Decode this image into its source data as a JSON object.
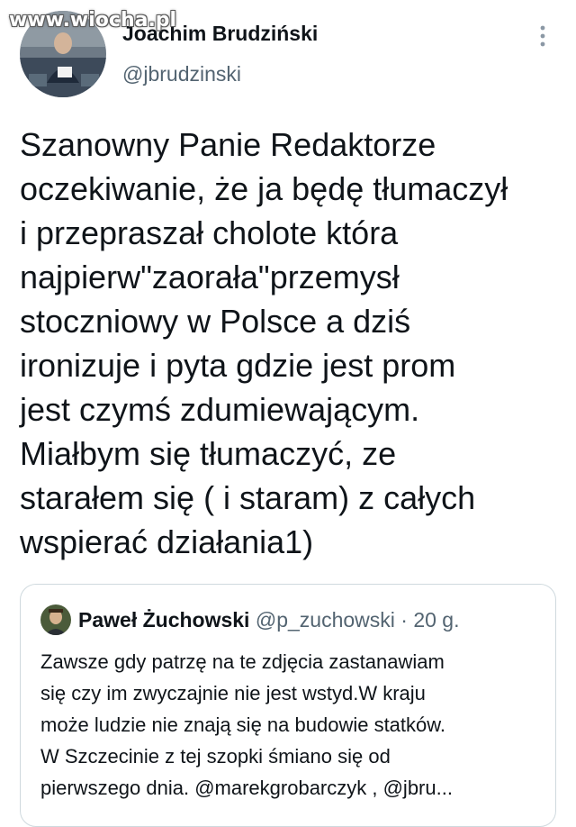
{
  "watermark": "www.wiocha.pl",
  "tweet": {
    "display_name": "Joachim Brudziński",
    "handle": "@jbrudzinski",
    "lines": [
      "Szanowny Panie Redaktorze",
      "oczekiwanie, że ja będę tłumaczył",
      "i przepraszał cholote która",
      "najpierw\"zaorała\"przemysł",
      "stoczniowy w Polsce a dziś",
      "ironizuje i pyta gdzie jest prom",
      "jest czymś zdumiewającym.",
      "Miałbym się tłumaczyć, ze",
      "starałem się ( i staram) z całych",
      "wspierać działania1)"
    ]
  },
  "quote": {
    "display_name": "Paweł Żuchowski",
    "handle": "@p_zuchowski",
    "separator": "·",
    "time": "20 g.",
    "lines": [
      "Zawsze gdy patrzę na te zdjęcia zastanawiam",
      "się czy im zwyczajnie nie jest wstyd.W kraju",
      "może ludzie nie znają się na budowie statków.",
      "W Szczecinie z tej szopki śmiano się od",
      "pierwszego dnia. @marekgrobarczyk , @jbru..."
    ]
  },
  "icons": {
    "more": "more-vertical-icon"
  }
}
